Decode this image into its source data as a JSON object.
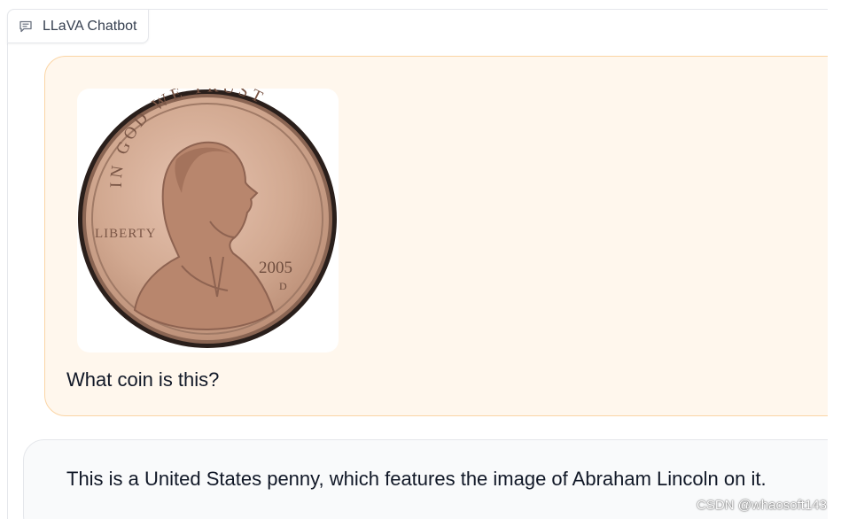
{
  "panel": {
    "label": "LLaVA Chatbot",
    "icon": "chat-icon"
  },
  "messages": [
    {
      "role": "user",
      "image": {
        "kind": "coin-photo",
        "inscriptions": {
          "motto": "IN GOD WE TRUST",
          "liberty": "LIBERTY",
          "year": "2005",
          "mint_mark": "D"
        }
      },
      "text": "What coin is this?"
    },
    {
      "role": "bot",
      "text": "This is a United States penny, which features the image of Abraham Lincoln on it."
    }
  ],
  "watermark": "CSDN @whaosoft143",
  "colors": {
    "user_bubble_bg": "#fff7ed",
    "user_bubble_border": "#fbd5a5",
    "bot_bubble_bg": "#f9fafb",
    "coin_copper": "#c89c86"
  }
}
